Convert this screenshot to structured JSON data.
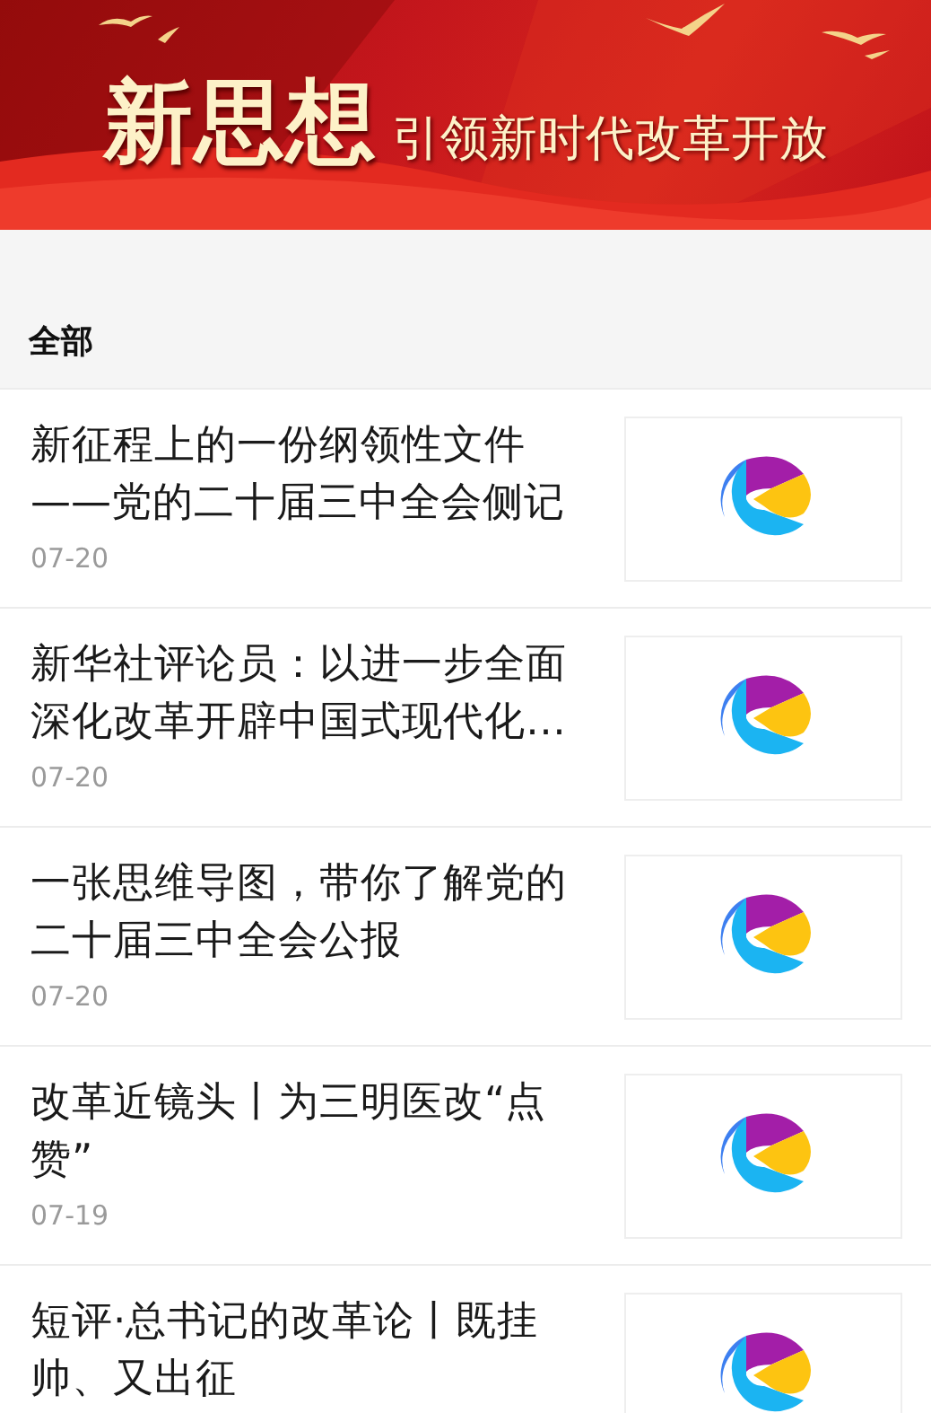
{
  "banner": {
    "title": "新思想",
    "subtitle": "引领新时代改革开放"
  },
  "section": {
    "title": "全部"
  },
  "articles": [
    {
      "title": "新征程上的一份纲领性文件——党的二十届三中全会侧记",
      "date": "07-20"
    },
    {
      "title": "新华社评论员：以进一步全面深化改革开辟中国式现代化…",
      "date": "07-20"
    },
    {
      "title": "一张思维导图，带你了解党的二十届三中全会公报",
      "date": "07-20"
    },
    {
      "title": "改革近镜头丨为三明医改“点赞”",
      "date": "07-19"
    },
    {
      "title": "短评·总书记的改革论丨既挂帅、又出征"
    }
  ]
}
